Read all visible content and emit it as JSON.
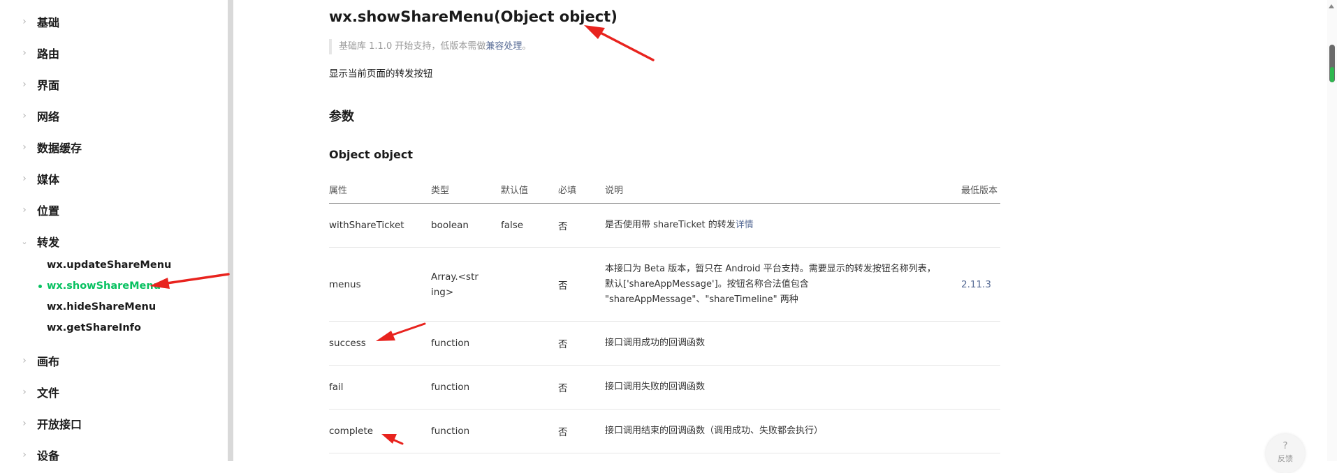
{
  "sidebar": {
    "items": [
      {
        "label": "基础"
      },
      {
        "label": "路由"
      },
      {
        "label": "界面"
      },
      {
        "label": "网络"
      },
      {
        "label": "数据缓存"
      },
      {
        "label": "媒体"
      },
      {
        "label": "位置"
      },
      {
        "label": "转发"
      },
      {
        "label": "画布"
      },
      {
        "label": "文件"
      },
      {
        "label": "开放接口"
      },
      {
        "label": "设备"
      }
    ],
    "share_sub_items": [
      {
        "label": "wx.updateShareMenu"
      },
      {
        "label": "wx.showShareMenu"
      },
      {
        "label": "wx.hideShareMenu"
      },
      {
        "label": "wx.getShareInfo"
      }
    ],
    "active_sub_item": "wx.showShareMenu"
  },
  "main": {
    "title": "wx.showShareMenu(Object object)",
    "version_note": {
      "prefix": "基础库 1.1.0 开始支持，低版本需做",
      "link": "兼容处理",
      "suffix": "。"
    },
    "description": "显示当前页面的转发按钮",
    "params_heading": "参数",
    "object_heading": "Object object",
    "table": {
      "headers": [
        "属性",
        "类型",
        "默认值",
        "必填",
        "说明",
        "最低版本"
      ],
      "rows": [
        {
          "name": "withShareTicket",
          "type": "boolean",
          "default": "false",
          "required": "否",
          "desc": "是否使用带 shareTicket 的转发",
          "desc_link": "详情",
          "min_version": ""
        },
        {
          "name": "menus",
          "type": "Array.<string>",
          "default": "",
          "required": "否",
          "desc": "本接口为 Beta 版本，暂只在 Android 平台支持。需要显示的转发按钮名称列表，默认['shareAppMessage']。按钮名称合法值包含 \"shareAppMessage\"、\"shareTimeline\" 两种",
          "desc_link": "",
          "min_version": "2.11.3"
        },
        {
          "name": "success",
          "type": "function",
          "default": "",
          "required": "否",
          "desc": "接口调用成功的回调函数",
          "desc_link": "",
          "min_version": ""
        },
        {
          "name": "fail",
          "type": "function",
          "default": "",
          "required": "否",
          "desc": "接口调用失败的回调函数",
          "desc_link": "",
          "min_version": ""
        },
        {
          "name": "complete",
          "type": "function",
          "default": "",
          "required": "否",
          "desc": "接口调用结束的回调函数（调用成功、失败都会执行）",
          "desc_link": "",
          "min_version": ""
        }
      ]
    }
  },
  "feedback": {
    "icon": "?",
    "label": "反馈"
  },
  "colors": {
    "accent": "#07c160",
    "link": "#576b95",
    "annotation_arrow": "#e8231e"
  },
  "icons": {
    "collapsed": "chevron-right-icon",
    "expanded": "chevron-down-icon"
  }
}
